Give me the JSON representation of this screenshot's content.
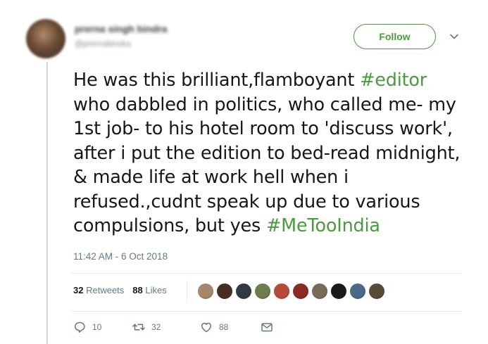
{
  "author": {
    "name": "prerna singh bindra",
    "handle": "@prernabindra"
  },
  "follow_label": "Follow",
  "tweet": {
    "segments": [
      {
        "text": "He was this brilliant,flamboyant ",
        "hashtag": false
      },
      {
        "text": "#editor",
        "hashtag": true
      },
      {
        "text": " who dabbled in politics, who called me- my 1st job- to his hotel room to 'discuss work', after i put the edition to bed-read midnight, & made life at work hell when i refused.,cudnt speak up due to various compulsions, but yes ",
        "hashtag": false
      },
      {
        "text": "#MeTooIndia",
        "hashtag": true
      }
    ],
    "timestamp": "11:42 AM - 6 Oct 2018"
  },
  "stats": {
    "retweets_count": "32",
    "retweets_label": "Retweets",
    "likes_count": "88",
    "likes_label": "Likes"
  },
  "liker_avatars": [
    "#a7876b",
    "#4a2d22",
    "#2f3a45",
    "#6f7d4a",
    "#b84a3a",
    "#8a2a22",
    "#7a6a5a",
    "#1a1a1a",
    "#4a6a8a",
    "#5a4a3a"
  ],
  "actions": {
    "reply_count": "10",
    "retweet_count": "32",
    "like_count": "88"
  },
  "colors": {
    "accent": "#4a9a3e",
    "muted": "#657786",
    "text": "#14171a"
  }
}
